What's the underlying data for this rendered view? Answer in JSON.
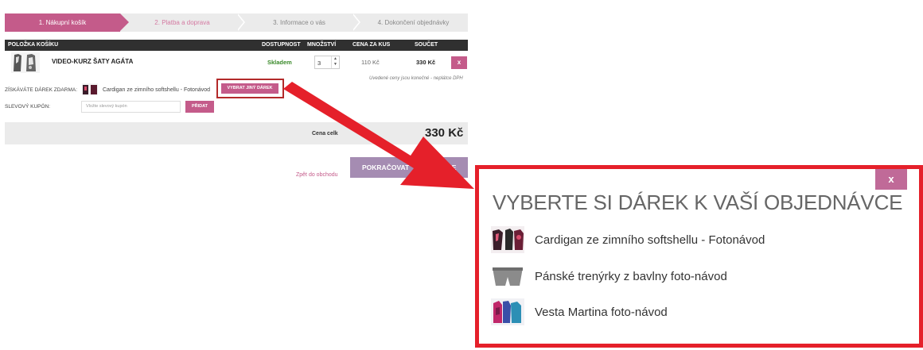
{
  "steps": [
    {
      "label": "1. Nákupní košík",
      "state": "active"
    },
    {
      "label": "2. Platba a doprava",
      "state": "next"
    },
    {
      "label": "3. Informace o vás",
      "state": "pending"
    },
    {
      "label": "4. Dokončení objednávky",
      "state": "pending"
    }
  ],
  "table": {
    "headers": [
      "POLOŽKA KOŠÍKU",
      "DOSTUPNOST",
      "MNOŽSTVÍ",
      "CENA ZA KUS",
      "SOUČET"
    ],
    "item": {
      "name": "VIDEO-KURZ ŠATY AGÁTA",
      "availability": "Skladem",
      "quantity": "3",
      "unit_price": "110 Kč",
      "total": "330 Kč",
      "remove": "x"
    },
    "vat_note": "Uvedené ceny jsou konečné - neplátce DPH"
  },
  "gift": {
    "label": "ZÍSKÁVÁTE DÁREK ZDARMA:",
    "name": "Cardigan ze zimního softshellu - Fotonávod",
    "button": "VYBRAT JINÝ DÁREK"
  },
  "coupon": {
    "label": "SLEVOVÝ KUPÓN:",
    "placeholder": "Vložte slevový kupón",
    "button": "PŘIDAT"
  },
  "total": {
    "label": "Cena celk",
    "value": "330 Kč"
  },
  "actions": {
    "continue": "POKRAČOVAT",
    "continue_tail": "VCE",
    "back": "Zpět do obchodu"
  },
  "modal": {
    "close": "x",
    "title": "VYBERTE SI DÁREK K VAŠÍ OBJEDNÁVCE",
    "gifts": [
      {
        "label": "Cardigan ze zimního softshellu - Fotonávod",
        "icon": "cardigan-thumbnail"
      },
      {
        "label": "Pánské trenýrky z bavlny foto-návod",
        "icon": "boxer-shorts-thumbnail"
      },
      {
        "label": "Vesta Martina foto-návod",
        "icon": "vest-thumbnail"
      }
    ]
  },
  "colors": {
    "accent": "#c45b8a",
    "arrow": "#e5202a",
    "stock_green": "#3a8a2a"
  }
}
